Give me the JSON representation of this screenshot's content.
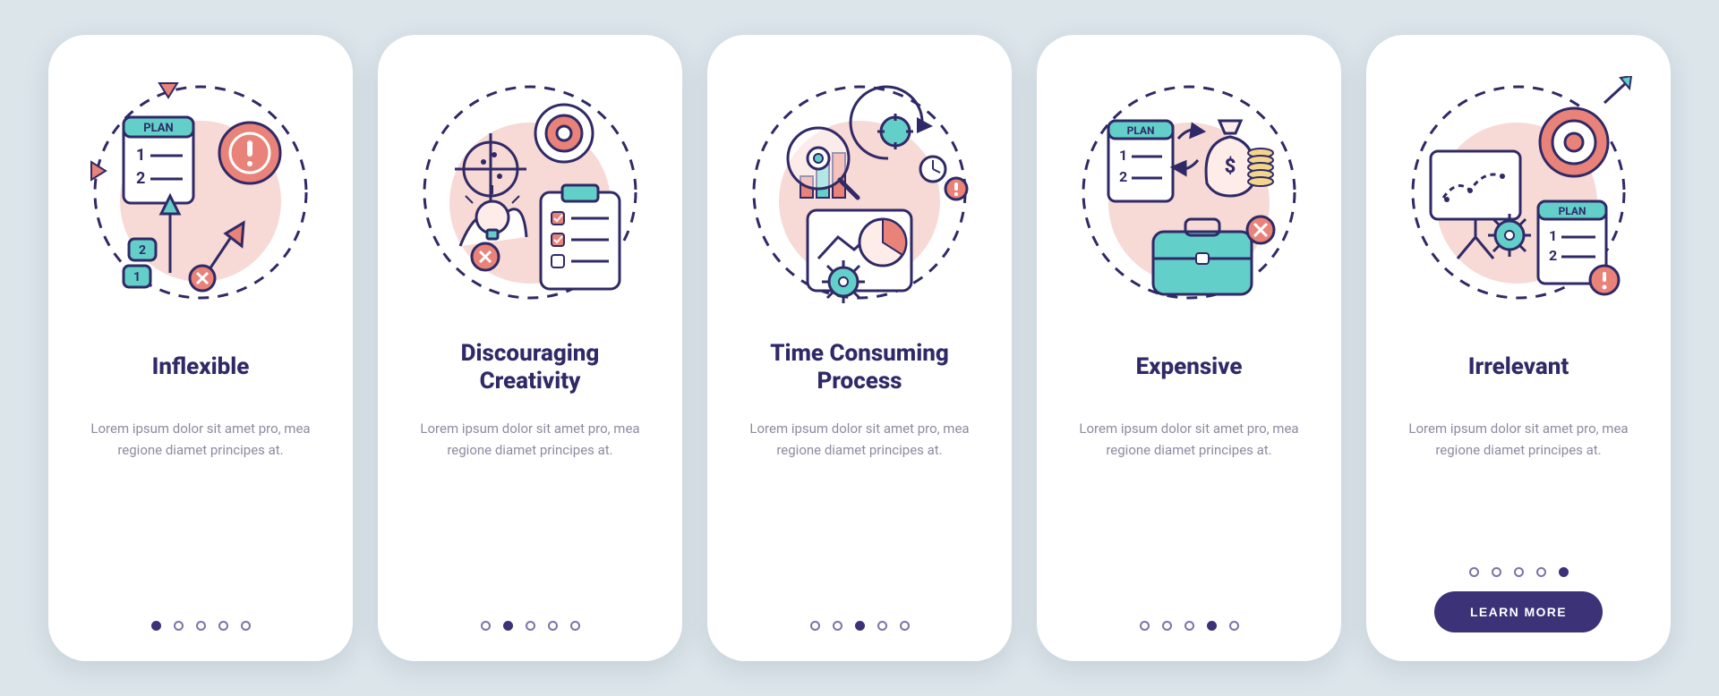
{
  "sharedBody": "Lorem ipsum dolor sit amet pro, mea regione diamet principes at.",
  "cta": {
    "label": "LEARN MORE"
  },
  "colors": {
    "ink": "#2f2a67",
    "stroke": "#2f2a67",
    "teal": "#63cfc9",
    "tealFill": "#9fe2dd",
    "coral": "#e98278",
    "coralSoft": "#f7cfc8",
    "pink": "#f7d9d5",
    "white": "#ffffff",
    "pageBg": "#dbe5ea",
    "cardBg": "#ffffff",
    "muted": "#8e8ba0",
    "dot": "#7a74a9",
    "dotActive": "#3b3277",
    "cta": "#3b3277"
  },
  "cards": [
    {
      "id": "inflexible",
      "title": "Inflexible",
      "iconName": "inflexible-icon",
      "activeIndex": 0,
      "showCta": false
    },
    {
      "id": "discouraging-creativity",
      "title": "Discouraging\nCreativity",
      "iconName": "discouraging-creativity-icon",
      "activeIndex": 1,
      "showCta": false
    },
    {
      "id": "time-consuming",
      "title": "Time Consuming\nProcess",
      "iconName": "time-consuming-icon",
      "activeIndex": 2,
      "showCta": false
    },
    {
      "id": "expensive",
      "title": "Expensive",
      "iconName": "expensive-icon",
      "activeIndex": 3,
      "showCta": false
    },
    {
      "id": "irrelevant",
      "title": "Irrelevant",
      "iconName": "irrelevant-icon",
      "activeIndex": 4,
      "showCta": true
    }
  ],
  "pagerCount": 5
}
